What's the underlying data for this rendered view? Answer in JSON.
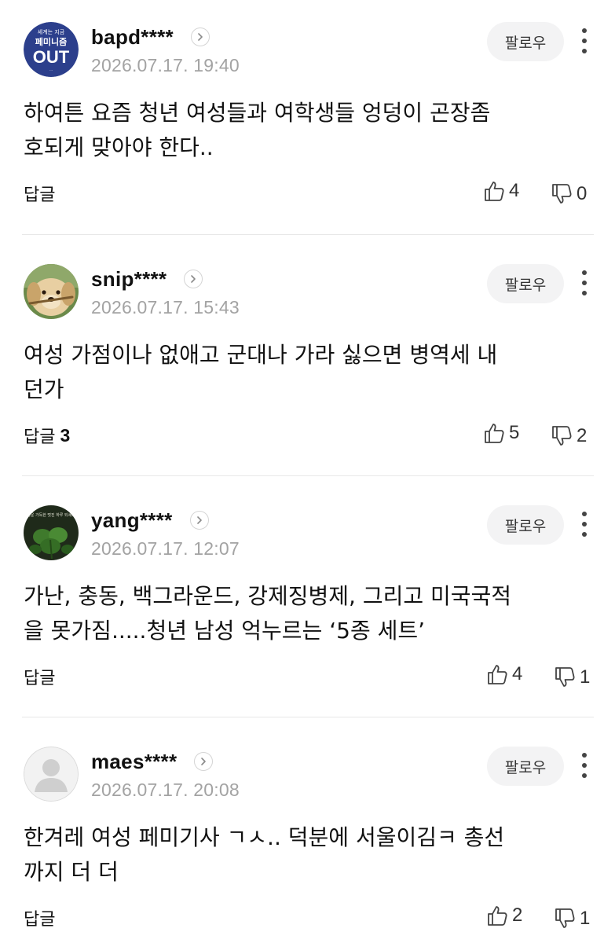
{
  "comments": [
    {
      "username": "bapd****",
      "timestamp": "2026.07.17. 19:40",
      "follow_label": "팔로우",
      "text": "하여튼 요즘 청년 여성들과 여학생들 엉덩이 곤장좀\n호되게 맞아야 한다..",
      "reply_label": "답글",
      "reply_count": "",
      "likes": "4",
      "dislikes": "0",
      "avatar": {
        "type": "badge",
        "top_text": "세계는 지금",
        "mid_text": "페미니즘",
        "big_text": "OUT",
        "bottom_text": "...",
        "bg_color": "#2c3f8c"
      }
    },
    {
      "username": "snip****",
      "timestamp": "2026.07.17. 15:43",
      "follow_label": "팔로우",
      "text": "여성 가점이나 없애고 군대나 가라 싫으면 병역세 내\n던가",
      "reply_label": "답글",
      "reply_count": "3",
      "likes": "5",
      "dislikes": "2",
      "avatar": {
        "type": "puppy-photo"
      }
    },
    {
      "username": "yang****",
      "timestamp": "2026.07.17. 12:07",
      "follow_label": "팔로우",
      "text": "가난, 충동, 백그라운드, 강제징병제, 그리고 미국국적\n을 못가짐.....청년 남성 억누르는 ‘5종 세트’",
      "reply_label": "답글",
      "reply_count": "",
      "likes": "4",
      "dislikes": "1",
      "avatar": {
        "type": "clover-photo",
        "caption": "행운 가득한 멋진 하루 되세요"
      }
    },
    {
      "username": "maes****",
      "timestamp": "2026.07.17. 20:08",
      "follow_label": "팔로우",
      "text": "한겨레 여성 페미기사 ㄱㅅ.. 덕분에 서울이김ㅋ 총선\n까지 더 더",
      "reply_label": "답글",
      "reply_count": "",
      "likes": "2",
      "dislikes": "1",
      "avatar": {
        "type": "default"
      }
    }
  ],
  "icons": {
    "profile": "chevron-right-icon",
    "more": "more-vertical-icon",
    "like": "thumbs-up-icon",
    "dislike": "thumbs-down-icon"
  },
  "colors": {
    "text": "#111111",
    "timestamp": "#a3a3a3",
    "follow_bg": "#f3f3f4",
    "divider": "#e8e8e8"
  }
}
